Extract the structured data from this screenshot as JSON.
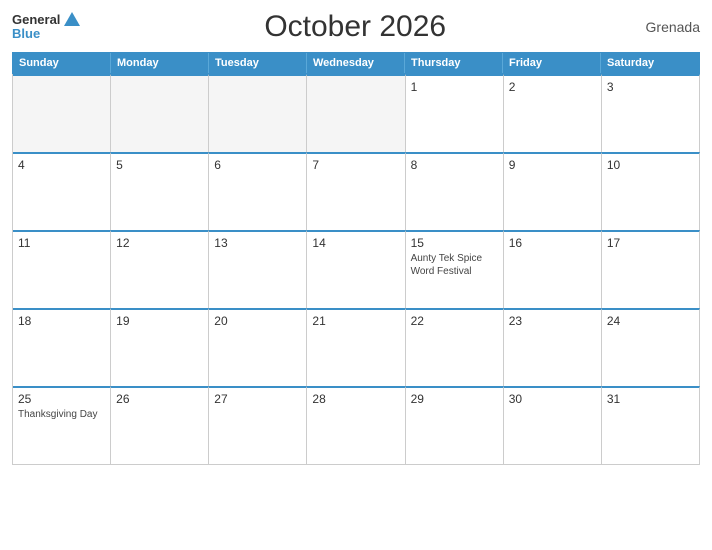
{
  "header": {
    "title": "October 2026",
    "country": "Grenada",
    "logo": {
      "general": "General",
      "blue": "Blue"
    }
  },
  "days_of_week": [
    "Sunday",
    "Monday",
    "Tuesday",
    "Wednesday",
    "Thursday",
    "Friday",
    "Saturday"
  ],
  "weeks": [
    [
      {
        "day": "",
        "empty": true
      },
      {
        "day": "",
        "empty": true
      },
      {
        "day": "",
        "empty": true
      },
      {
        "day": "",
        "empty": true
      },
      {
        "day": "1",
        "empty": false,
        "event": ""
      },
      {
        "day": "2",
        "empty": false,
        "event": ""
      },
      {
        "day": "3",
        "empty": false,
        "event": ""
      }
    ],
    [
      {
        "day": "4",
        "empty": false,
        "event": ""
      },
      {
        "day": "5",
        "empty": false,
        "event": ""
      },
      {
        "day": "6",
        "empty": false,
        "event": ""
      },
      {
        "day": "7",
        "empty": false,
        "event": ""
      },
      {
        "day": "8",
        "empty": false,
        "event": ""
      },
      {
        "day": "9",
        "empty": false,
        "event": ""
      },
      {
        "day": "10",
        "empty": false,
        "event": ""
      }
    ],
    [
      {
        "day": "11",
        "empty": false,
        "event": ""
      },
      {
        "day": "12",
        "empty": false,
        "event": ""
      },
      {
        "day": "13",
        "empty": false,
        "event": ""
      },
      {
        "day": "14",
        "empty": false,
        "event": ""
      },
      {
        "day": "15",
        "empty": false,
        "event": "Aunty Tek Spice Word Festival"
      },
      {
        "day": "16",
        "empty": false,
        "event": ""
      },
      {
        "day": "17",
        "empty": false,
        "event": ""
      }
    ],
    [
      {
        "day": "18",
        "empty": false,
        "event": ""
      },
      {
        "day": "19",
        "empty": false,
        "event": ""
      },
      {
        "day": "20",
        "empty": false,
        "event": ""
      },
      {
        "day": "21",
        "empty": false,
        "event": ""
      },
      {
        "day": "22",
        "empty": false,
        "event": ""
      },
      {
        "day": "23",
        "empty": false,
        "event": ""
      },
      {
        "day": "24",
        "empty": false,
        "event": ""
      }
    ],
    [
      {
        "day": "25",
        "empty": false,
        "event": "Thanksgiving Day"
      },
      {
        "day": "26",
        "empty": false,
        "event": ""
      },
      {
        "day": "27",
        "empty": false,
        "event": ""
      },
      {
        "day": "28",
        "empty": false,
        "event": ""
      },
      {
        "day": "29",
        "empty": false,
        "event": ""
      },
      {
        "day": "30",
        "empty": false,
        "event": ""
      },
      {
        "day": "31",
        "empty": false,
        "event": ""
      }
    ]
  ]
}
